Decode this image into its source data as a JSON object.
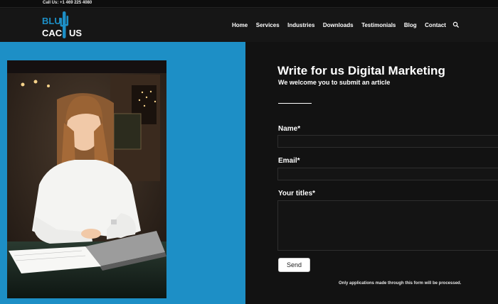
{
  "topbar": {
    "phone": "Call Us: +1 469 225 4080"
  },
  "brand": {
    "line1": "BLU",
    "line2a": "CAC",
    "line2b": "US",
    "accent": "#1d8fc6"
  },
  "nav": {
    "items": [
      "Home",
      "Services",
      "Industries",
      "Downloads",
      "Testimonials",
      "Blog",
      "Contact"
    ],
    "search_icon": "search-icon"
  },
  "hero": {
    "image_alt": ""
  },
  "form": {
    "title": "Write for us Digital Marketing",
    "subtitle": "We welcome you to submit an article",
    "name_label": "Name*",
    "name_value": "",
    "email_label": "Email*",
    "email_value": "",
    "titles_label": "Your titles*",
    "titles_value": "",
    "send_label": "Send",
    "note": "Only applications made through this form will be processed."
  },
  "colors": {
    "left_panel": "#1d8fc6",
    "background": "#121212"
  }
}
